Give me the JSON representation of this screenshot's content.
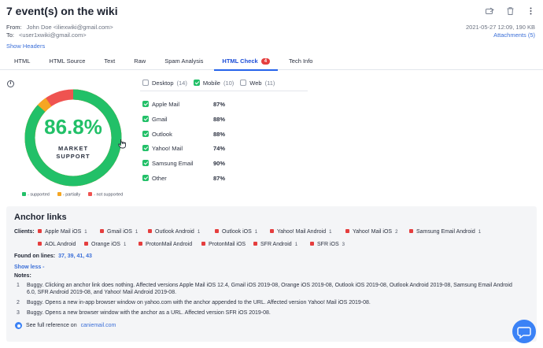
{
  "header": {
    "title": "7 event(s) on the wiki",
    "from_label": "From:",
    "from_value": "John Doe <iliexwiki@gmail.com>",
    "to_label": "To:",
    "to_value": "<user1xwiki@gmail.com>",
    "date": "2021-05-27 12:09, 190 KB",
    "attachments": "Attachments (5)",
    "show_headers": "Show Headers",
    "icons": [
      "forward-icon",
      "trash-icon",
      "more-icon"
    ]
  },
  "tabs": [
    {
      "label": "HTML"
    },
    {
      "label": "HTML Source"
    },
    {
      "label": "Text"
    },
    {
      "label": "Raw"
    },
    {
      "label": "Spam Analysis"
    },
    {
      "label": "HTML Check",
      "badge": "4",
      "active": true
    },
    {
      "label": "Tech Info"
    }
  ],
  "support": {
    "percent": "86.8%",
    "percent_value": 86.8,
    "partial_value": 3.5,
    "label_line1": "MARKET",
    "label_line2": "SUPPORT",
    "colors": {
      "supported": "#22c068",
      "partial": "#f5a623",
      "not_supported": "#ef5350"
    },
    "legend": [
      "- supported",
      "- partially",
      "- not supported"
    ]
  },
  "filters": [
    {
      "label": "Desktop",
      "count": "(14)",
      "checked": false
    },
    {
      "label": "Mobile",
      "count": "(10)",
      "checked": true
    },
    {
      "label": "Web",
      "count": "(11)",
      "checked": false
    }
  ],
  "clients": [
    {
      "name": "Apple Mail",
      "value": "87%"
    },
    {
      "name": "Gmail",
      "value": "88%"
    },
    {
      "name": "Outlook",
      "value": "88%"
    },
    {
      "name": "Yahoo! Mail",
      "value": "74%"
    },
    {
      "name": "Samsung Email",
      "value": "90%"
    },
    {
      "name": "Other",
      "value": "87%"
    }
  ],
  "anchor": {
    "title": "Anchor links",
    "clients_label": "Clients:",
    "chips": [
      {
        "name": "Apple Mail iOS",
        "n": "1"
      },
      {
        "name": "Gmail iOS",
        "n": "1"
      },
      {
        "name": "Outlook Android",
        "n": "1"
      },
      {
        "name": "Outlook iOS",
        "n": "1"
      },
      {
        "name": "Yahoo! Mail Android",
        "n": "1"
      },
      {
        "name": "Yahoo! Mail iOS",
        "n": "2"
      },
      {
        "name": "Samsung Email Android",
        "n": "1"
      },
      {
        "name": "AOL Android",
        "n": ""
      },
      {
        "name": "Orange iOS",
        "n": "1"
      },
      {
        "name": "ProtonMail Android",
        "n": ""
      },
      {
        "name": "ProtonMail iOS",
        "n": ""
      },
      {
        "name": "SFR Android",
        "n": "1"
      },
      {
        "name": "SFR iOS",
        "n": "3"
      }
    ],
    "found_label": "Found on lines:",
    "found_lines": "37, 39, 41, 43",
    "show_less": "Show less -",
    "notes_label": "Notes:",
    "notes": [
      {
        "num": "1",
        "text": "Buggy. Clicking an anchor link does nothing. Affected versions Apple Mail iOS 12.4, Gmail iOS 2019-08, Orange iOS 2019-08, Outlook iOS 2019-08, Outlook Android 2019-08, Samsung Email Android 6.0, SFR Android 2019-08, and Yahoo! Mail Android 2019-08."
      },
      {
        "num": "2",
        "text": "Buggy. Opens a new in-app browser window on yahoo.com with the anchor appended to the URL. Affected version Yahoo! Mail iOS 2019-08."
      },
      {
        "num": "3",
        "text": "Buggy. Opens a new browser window with the anchor as a URL. Affected version SFR iOS 2019-08."
      }
    ],
    "reference_text": "See full reference on",
    "reference_link": "caniemail.com"
  }
}
